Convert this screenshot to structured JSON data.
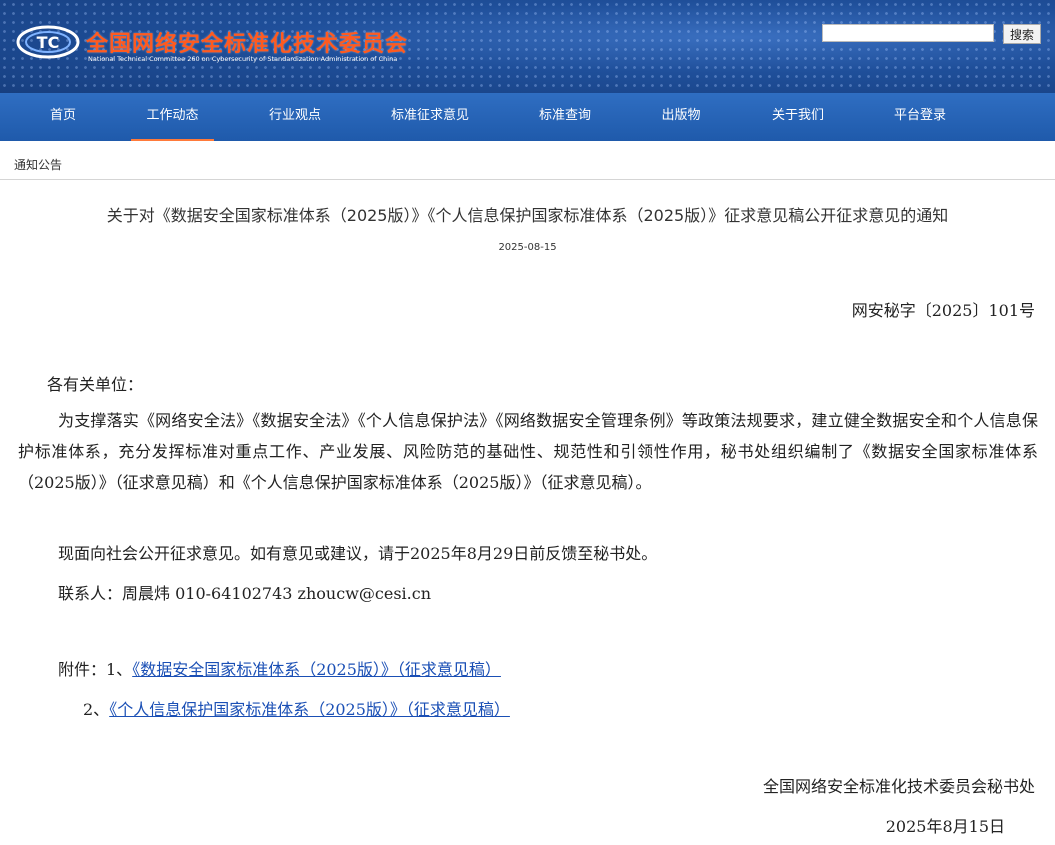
{
  "header": {
    "title": "全国网络安全标准化技术委员会",
    "subtitle": "National Technical Committee 260 on Cybersecurity of Standardization Administration of China",
    "logo_text": "TC",
    "search_placeholder": "",
    "search_button": "搜索"
  },
  "nav": {
    "items": [
      {
        "label": "首页"
      },
      {
        "label": "工作动态"
      },
      {
        "label": "行业观点"
      },
      {
        "label": "标准征求意见"
      },
      {
        "label": "标准查询"
      },
      {
        "label": "出版物"
      },
      {
        "label": "关于我们"
      },
      {
        "label": "平台登录"
      }
    ],
    "active_index": 1
  },
  "breadcrumb": "通知公告",
  "article": {
    "title": "关于对《数据安全国家标准体系（2025版）》《个人信息保护国家标准体系（2025版）》征求意见稿公开征求意见的通知",
    "date": "2025-08-15",
    "doc_number": "网安秘字〔2025〕101号",
    "salutation": "各有关单位：",
    "para1": "为支撑落实《网络安全法》《数据安全法》《个人信息保护法》《网络数据安全管理条例》等政策法规要求，建立健全数据安全和个人信息保护标准体系，充分发挥标准对重点工作、产业发展、风险防范的基础性、规范性和引领性作用，秘书处组织编制了《数据安全国家标准体系（2025版）》（征求意见稿）和《个人信息保护国家标准体系（2025版）》（征求意见稿）。",
    "para2": "现面向社会公开征求意见。如有意见或建议，请于2025年8月29日前反馈至秘书处。",
    "contact": "联系人：周晨炜  010-64102743  zhoucw@cesi.cn",
    "attachments": [
      {
        "prefix": "附件：1、",
        "link": "《数据安全国家标准体系（2025版）》（征求意见稿）"
      },
      {
        "prefix": "2、",
        "link": "《个人信息保护国家标准体系（2025版）》（征求意见稿）"
      }
    ],
    "sign_org": "全国网络安全标准化技术委员会秘书处",
    "sign_date": "2025年8月15日"
  },
  "colors": {
    "header_bg": "#1f4f9a",
    "nav_bg": "#2a66b8",
    "title_accent": "#ff5a1f",
    "nav_active_underline": "#ff7a3a",
    "link": "#1a4fb5"
  }
}
